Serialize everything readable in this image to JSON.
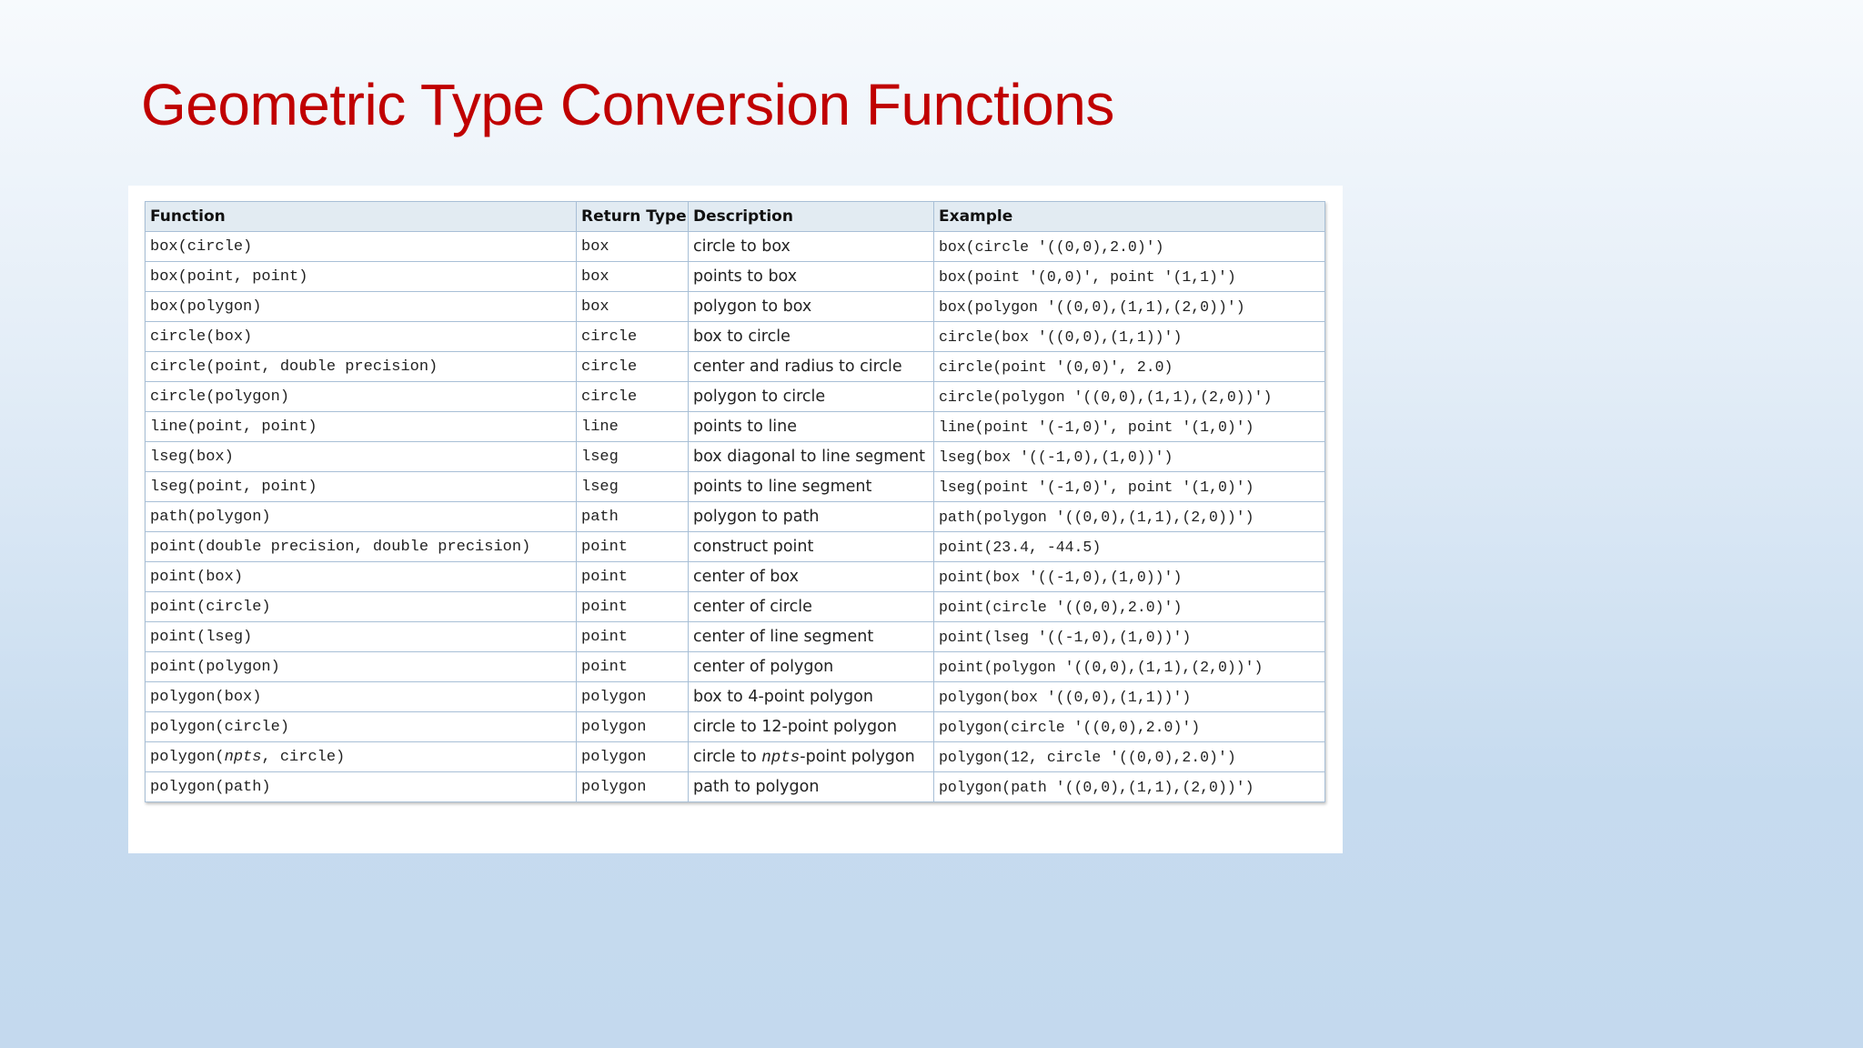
{
  "title": "Geometric Type Conversion Functions",
  "table": {
    "headers": [
      "Function",
      "Return Type",
      "Description",
      "Example"
    ],
    "rows": [
      {
        "function": "box(circle)",
        "return_type": "box",
        "description": "circle to box",
        "example": "box(circle '((0,0),2.0)')"
      },
      {
        "function": "box(point, point)",
        "return_type": "box",
        "description": "points to box",
        "example": "box(point '(0,0)', point '(1,1)')"
      },
      {
        "function": "box(polygon)",
        "return_type": "box",
        "description": "polygon to box",
        "example": "box(polygon '((0,0),(1,1),(2,0))')"
      },
      {
        "function": "circle(box)",
        "return_type": "circle",
        "description": "box to circle",
        "example": "circle(box '((0,0),(1,1))')"
      },
      {
        "function": "circle(point, double precision)",
        "return_type": "circle",
        "description": "center and radius to circle",
        "example": "circle(point '(0,0)', 2.0)"
      },
      {
        "function": "circle(polygon)",
        "return_type": "circle",
        "description": "polygon to circle",
        "example": "circle(polygon '((0,0),(1,1),(2,0))')"
      },
      {
        "function": "line(point, point)",
        "return_type": "line",
        "description": "points to line",
        "example": "line(point '(-1,0)', point '(1,0)')"
      },
      {
        "function": "lseg(box)",
        "return_type": "lseg",
        "description": "box diagonal to line segment",
        "example": "lseg(box '((-1,0),(1,0))')"
      },
      {
        "function": "lseg(point, point)",
        "return_type": "lseg",
        "description": "points to line segment",
        "example": "lseg(point '(-1,0)', point '(1,0)')"
      },
      {
        "function": "path(polygon)",
        "return_type": "path",
        "description": "polygon to path",
        "example": "path(polygon '((0,0),(1,1),(2,0))')"
      },
      {
        "function": "point(double precision, double precision)",
        "return_type": "point",
        "description": "construct point",
        "example": "point(23.4, -44.5)"
      },
      {
        "function": "point(box)",
        "return_type": "point",
        "description": "center of box",
        "example": "point(box '((-1,0),(1,0))')"
      },
      {
        "function": "point(circle)",
        "return_type": "point",
        "description": "center of circle",
        "example": "point(circle '((0,0),2.0)')"
      },
      {
        "function": "point(lseg)",
        "return_type": "point",
        "description": "center of line segment",
        "example": "point(lseg '((-1,0),(1,0))')"
      },
      {
        "function": "point(polygon)",
        "return_type": "point",
        "description": "center of polygon",
        "example": "point(polygon '((0,0),(1,1),(2,0))')"
      },
      {
        "function": "polygon(box)",
        "return_type": "polygon",
        "description": "box to 4-point polygon",
        "example": "polygon(box '((0,0),(1,1))')"
      },
      {
        "function": "polygon(circle)",
        "return_type": "polygon",
        "description": "circle to 12-point polygon",
        "example": "polygon(circle '((0,0),2.0)')"
      },
      {
        "function_prefix": "polygon(",
        "function_italic": "npts",
        "function_suffix": ", circle)",
        "return_type": "polygon",
        "description_prefix": "circle to ",
        "description_italic": "npts",
        "description_suffix": "-point polygon",
        "example": "polygon(12, circle '((0,0),2.0)')"
      },
      {
        "function": "polygon(path)",
        "return_type": "polygon",
        "description": "path to polygon",
        "example": "polygon(path '((0,0),(1,1),(2,0))')"
      }
    ]
  },
  "colors": {
    "title": "#c00000",
    "header_bg": "#e2ebf2",
    "border": "#a8bfd6"
  }
}
